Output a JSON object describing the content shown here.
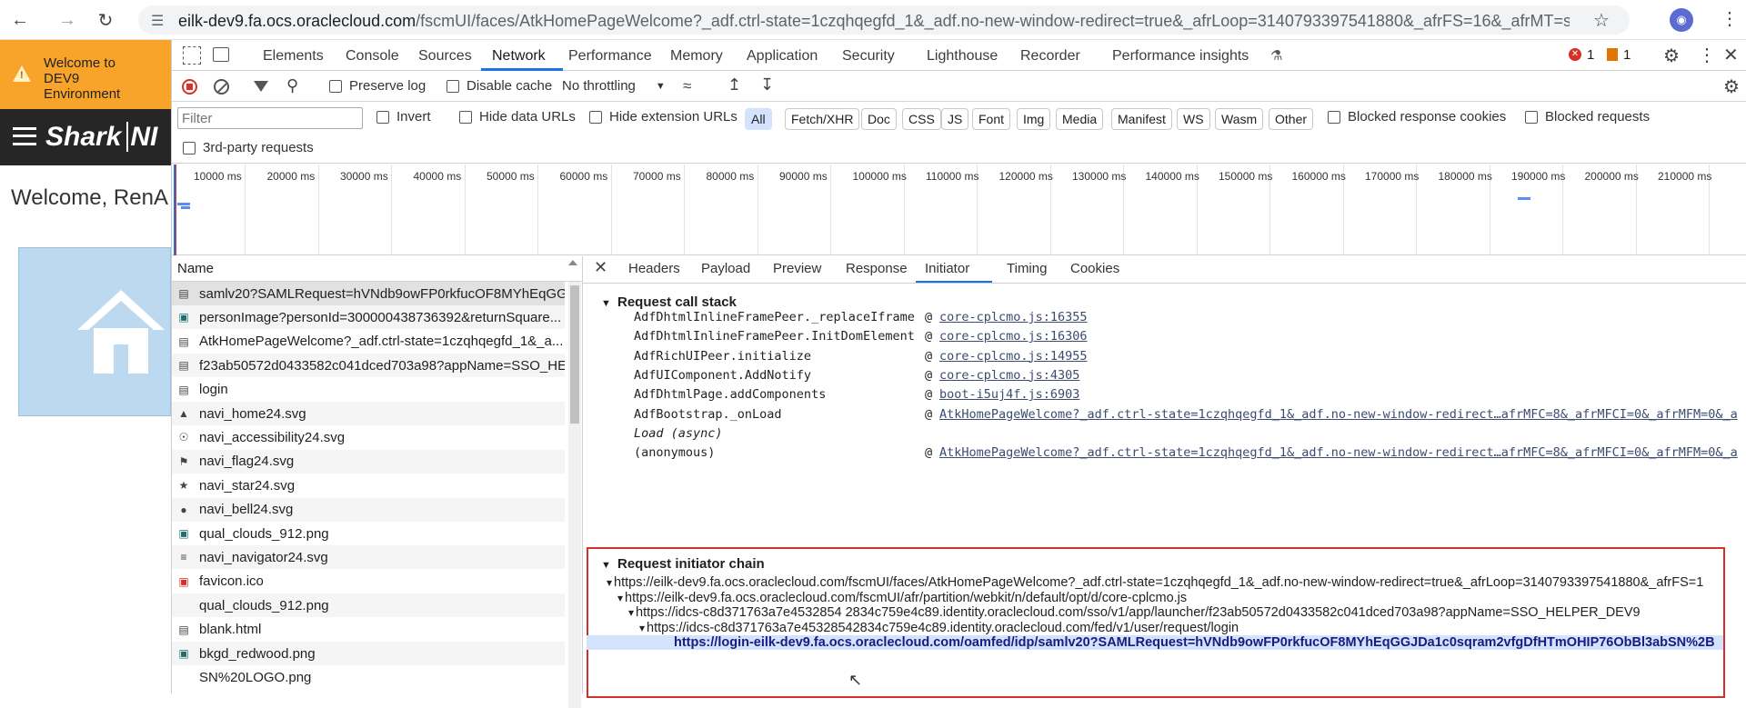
{
  "browser": {
    "url_domain": "eilk-dev9.fa.ocs.oraclecloud.com",
    "url_rest": "/fscmUI/faces/AtkHomePageWelcome?_adf.ctrl-state=1czqhqegfd_1&_adf.no-new-window-redirect=true&_afrLoop=3140793397541880&_afrFS=16&_afrMT=screen&_a..."
  },
  "app": {
    "banner_line1": "Welcome to",
    "banner_line2": "DEV9",
    "banner_line3": "Environment",
    "logo_text": "Shark",
    "logo_suffix": "NI",
    "welcome": "Welcome, RenA"
  },
  "devtools": {
    "tabs": [
      "Elements",
      "Console",
      "Sources",
      "Network",
      "Performance",
      "Memory",
      "Application",
      "Security",
      "Lighthouse",
      "Recorder",
      "Performance insights"
    ],
    "error_count": "1",
    "warning_count": "1",
    "toolbar": {
      "preserve_log": "Preserve log",
      "disable_cache": "Disable cache",
      "throttling": "No throttling"
    },
    "filter_placeholder": "Filter",
    "filters": {
      "invert": "Invert",
      "hide_data_urls": "Hide data URLs",
      "hide_extension_urls": "Hide extension URLs",
      "types": [
        "All",
        "Fetch/XHR",
        "Doc",
        "CSS",
        "JS",
        "Font",
        "Img",
        "Media",
        "Manifest",
        "WS",
        "Wasm",
        "Other"
      ],
      "blocked_cookies": "Blocked response cookies",
      "blocked_requests": "Blocked requests",
      "third_party": "3rd-party requests"
    },
    "timeline_ticks": [
      "10000 ms",
      "20000 ms",
      "30000 ms",
      "40000 ms",
      "50000 ms",
      "60000 ms",
      "70000 ms",
      "80000 ms",
      "90000 ms",
      "100000 ms",
      "110000 ms",
      "120000 ms",
      "130000 ms",
      "140000 ms",
      "150000 ms",
      "160000 ms",
      "170000 ms",
      "180000 ms",
      "190000 ms",
      "200000 ms",
      "210000 ms",
      "2"
    ],
    "requests_header": "Name",
    "requests": [
      {
        "name": "samlv20?SAMLRequest=hVNdb9owFP0rkfucOF8MYhEqGG...",
        "icon": "doc-icon"
      },
      {
        "name": "personImage?personId=300000438736392&returnSquare...",
        "icon": "img-icon"
      },
      {
        "name": "AtkHomePageWelcome?_adf.ctrl-state=1czqhqegfd_1&_a...",
        "icon": "doc-icon"
      },
      {
        "name": "f23ab50572d0433582c041dced703a98?appName=SSO_HE...",
        "icon": "doc-icon"
      },
      {
        "name": "login",
        "icon": "doc-icon"
      },
      {
        "name": "navi_home24.svg",
        "icon": "home-icon"
      },
      {
        "name": "navi_accessibility24.svg",
        "icon": "accessibility-icon"
      },
      {
        "name": "navi_flag24.svg",
        "icon": "flag-icon"
      },
      {
        "name": "navi_star24.svg",
        "icon": "star-icon"
      },
      {
        "name": "navi_bell24.svg",
        "icon": "bell-icon"
      },
      {
        "name": "qual_clouds_912.png",
        "icon": "img-icon"
      },
      {
        "name": "navi_navigator24.svg",
        "icon": "menu-icon"
      },
      {
        "name": "favicon.ico",
        "icon": "favicon-icon"
      },
      {
        "name": "qual_clouds_912.png",
        "icon": "blank-icon"
      },
      {
        "name": "blank.html",
        "icon": "doc-icon"
      },
      {
        "name": "bkgd_redwood.png",
        "icon": "img-icon"
      },
      {
        "name": "SN%20LOGO.png",
        "icon": "blank-icon"
      }
    ],
    "detail_tabs": [
      "Headers",
      "Payload",
      "Preview",
      "Response",
      "Initiator",
      "Timing",
      "Cookies"
    ],
    "call_stack_title": "Request call stack",
    "call_stack": [
      {
        "fn": "AdfDhtmlInlineFramePeer._replaceIframe",
        "link": "core-cplcmo.js:16355"
      },
      {
        "fn": "AdfDhtmlInlineFramePeer.InitDomElement",
        "link": "core-cplcmo.js:16306"
      },
      {
        "fn": "AdfRichUIPeer.initialize",
        "link": "core-cplcmo.js:14955"
      },
      {
        "fn": "AdfUIComponent.AddNotify",
        "link": "core-cplcmo.js:4305"
      },
      {
        "fn": "AdfDhtmlPage.addComponents",
        "link": "boot-i5uj4f.js:6903"
      },
      {
        "fn": "AdfBootstrap._onLoad",
        "link": "AtkHomePageWelcome?_adf.ctrl-state=1czqhqegfd_1&_adf.no-new-window-redirect…afrMFC=8&_afrMFCI=0&_afrMFM=0&_a"
      },
      {
        "fn": "Load (async)",
        "link": ""
      },
      {
        "fn": "(anonymous)",
        "link": "AtkHomePageWelcome?_adf.ctrl-state=1czqhqegfd_1&_adf.no-new-window-redirect…afrMFC=8&_afrMFCI=0&_afrMFM=0&_a"
      }
    ],
    "initiator_chain_title": "Request initiator chain",
    "initiator_chain": [
      "https://eilk-dev9.fa.ocs.oraclecloud.com/fscmUI/faces/AtkHomePageWelcome?_adf.ctrl-state=1czqhqegfd_1&_adf.no-new-window-redirect=true&_afrLoop=3140793397541880&_afrFS=1",
      "https://eilk-dev9.fa.ocs.oraclecloud.com/fscmUI/afr/partition/webkit/n/default/opt/d/core-cplcmo.js",
      "https://idcs-c8d371763a7e4532854 2834c759e4c89.identity.oraclecloud.com/sso/v1/app/launcher/f23ab50572d0433582c041dced703a98?appName=SSO_HELPER_DEV9",
      "https://idcs-c8d371763a7e45328542834c759e4c89.identity.oraclecloud.com/fed/v1/user/request/login",
      "https://login-eilk-dev9.fa.ocs.oraclecloud.com/oamfed/idp/samlv20?SAMLRequest=hVNdb9owFP0rkfucOF8MYhEqGGJDa1c0sqram2vfgDfHTmOHIP76ObBl3abSN%2B"
    ]
  }
}
